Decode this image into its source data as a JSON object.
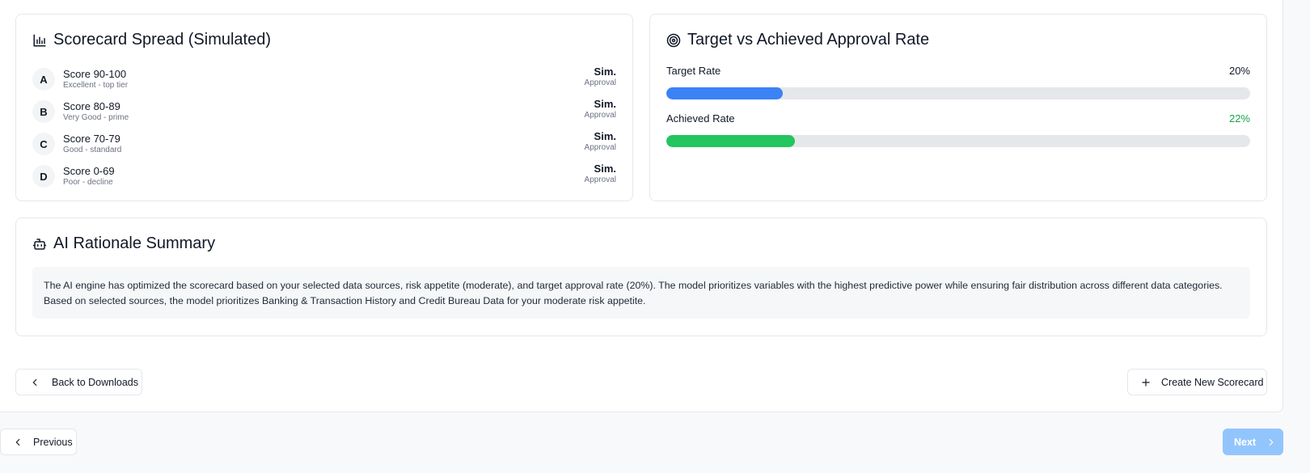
{
  "spread": {
    "title": "Scorecard Spread (Simulated)",
    "icon": "bar-chart-icon",
    "tiers": [
      {
        "grade": "A",
        "name": "Score 90-100",
        "desc": "Excellent - top tier",
        "value": "Sim.",
        "sub": "Approval"
      },
      {
        "grade": "B",
        "name": "Score 80-89",
        "desc": "Very Good - prime",
        "value": "Sim.",
        "sub": "Approval"
      },
      {
        "grade": "C",
        "name": "Score 70-79",
        "desc": "Good - standard",
        "value": "Sim.",
        "sub": "Approval"
      },
      {
        "grade": "D",
        "name": "Score 0-69",
        "desc": "Poor - decline",
        "value": "Sim.",
        "sub": "Approval"
      }
    ]
  },
  "rates": {
    "title": "Target vs Achieved Approval Rate",
    "icon": "target-icon",
    "target": {
      "label": "Target Rate",
      "value_text": "20%",
      "fraction": 0.2,
      "color": "#3b82f6"
    },
    "achieved": {
      "label": "Achieved Rate",
      "value_text": "22%",
      "fraction": 0.22,
      "color": "#22c55e"
    }
  },
  "rationale": {
    "title": "AI Rationale Summary",
    "icon": "bot-icon",
    "text": "The AI engine has optimized the scorecard based on your selected data sources, risk appetite (moderate), and target approval rate (20%). The model prioritizes variables with the highest predictive power while ensuring fair distribution across different data categories. Based on selected sources, the model prioritizes Banking & Transaction History and Credit Bureau Data for your moderate risk appetite."
  },
  "actions": {
    "back_label": "Back to Downloads",
    "create_label": "Create New Scorecard"
  },
  "wizard": {
    "previous_label": "Previous",
    "next_label": "Next"
  }
}
